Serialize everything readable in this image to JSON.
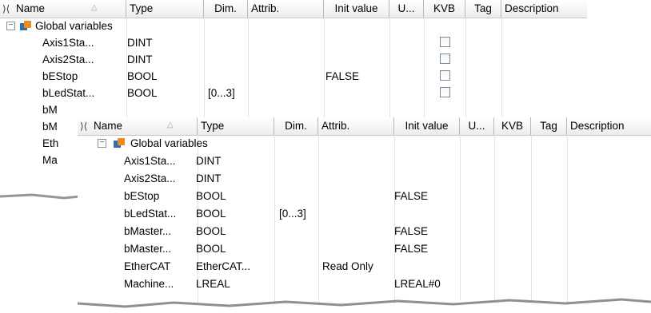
{
  "columns": {
    "name": "Name",
    "type": "Type",
    "dim": "Dim.",
    "attrib": "Attrib.",
    "init": "Init value",
    "u": "U...",
    "kvb": "KVB",
    "tag": "Tag",
    "description": "Description"
  },
  "group_label": "Global variables",
  "back_rows": [
    {
      "name": "Axis1Sta...",
      "type": "DINT",
      "dim": "",
      "attrib": "",
      "init": ""
    },
    {
      "name": "Axis2Sta...",
      "type": "DINT",
      "dim": "",
      "attrib": "",
      "init": ""
    },
    {
      "name": "bEStop",
      "type": "BOOL",
      "dim": "",
      "attrib": "",
      "init": "FALSE"
    },
    {
      "name": "bLedStat...",
      "type": "BOOL",
      "dim": "[0...3]",
      "attrib": "",
      "init": ""
    },
    {
      "name": "bM",
      "type": "",
      "dim": "",
      "attrib": "",
      "init": ""
    },
    {
      "name": "bM",
      "type": "",
      "dim": "",
      "attrib": "",
      "init": ""
    },
    {
      "name": "Eth",
      "type": "",
      "dim": "",
      "attrib": "",
      "init": ""
    },
    {
      "name": "Ma",
      "type": "",
      "dim": "",
      "attrib": "",
      "init": ""
    }
  ],
  "front_rows": [
    {
      "name": "Axis1Sta...",
      "type": "DINT",
      "dim": "",
      "attrib": "",
      "init": ""
    },
    {
      "name": "Axis2Sta...",
      "type": "DINT",
      "dim": "",
      "attrib": "",
      "init": ""
    },
    {
      "name": "bEStop",
      "type": "BOOL",
      "dim": "",
      "attrib": "",
      "init": "FALSE"
    },
    {
      "name": "bLedStat...",
      "type": "BOOL",
      "dim": "[0...3]",
      "attrib": "",
      "init": ""
    },
    {
      "name": "bMaster...",
      "type": "BOOL",
      "dim": "",
      "attrib": "",
      "init": "FALSE"
    },
    {
      "name": "bMaster...",
      "type": "BOOL",
      "dim": "",
      "attrib": "",
      "init": "FALSE"
    },
    {
      "name": "EtherCAT",
      "type": "EtherCAT...",
      "dim": "",
      "attrib": "Read Only",
      "init": ""
    },
    {
      "name": "Machine...",
      "type": "LREAL",
      "dim": "",
      "attrib": "",
      "init": "LREAL#0"
    }
  ],
  "colors": {
    "group_icon_blue": "#2f6eb5",
    "group_icon_orange": "#f08a1c",
    "header_border": "#b8b8b8"
  },
  "icons": {
    "pin": "pin-icon",
    "sort": "sort-arrow-icon",
    "expander": "collapse-icon",
    "group": "global-variables-icon",
    "checkbox": "kvb-checkbox"
  }
}
